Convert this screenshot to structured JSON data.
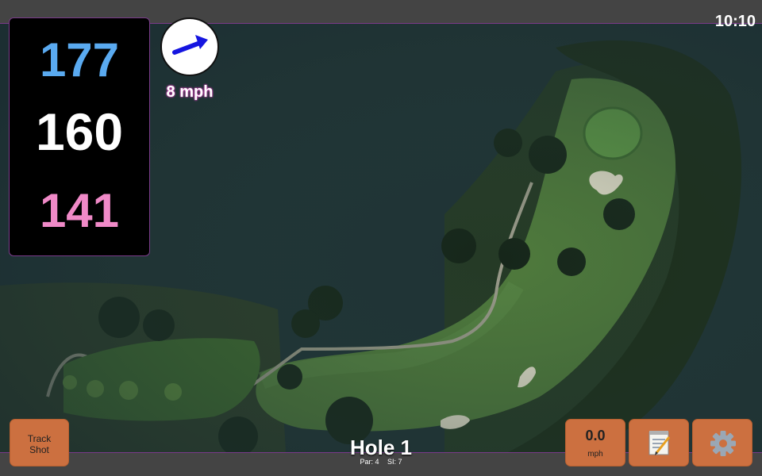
{
  "status_bar": {
    "time": "10:10"
  },
  "distances": {
    "back": "177",
    "middle": "160",
    "front": "141"
  },
  "wind": {
    "speed_text": "8 mph",
    "arrow_icon": "wind-direction-arrow-icon"
  },
  "hole": {
    "title": "Hole 1",
    "par": "Par: 4",
    "stroke_index": "SI: 7"
  },
  "buttons": {
    "track_shot_line1": "Track",
    "track_shot_line2": "Shot",
    "speed_value": "0.0",
    "speed_unit": "mph",
    "notes_icon": "notepad-icon",
    "settings_icon": "gear-icon"
  },
  "colors": {
    "back_distance": "#5aaaf0",
    "middle_distance": "#ffffff",
    "front_distance": "#f08ac8",
    "button": "#cc7040",
    "accent": "#7a3a8a"
  }
}
